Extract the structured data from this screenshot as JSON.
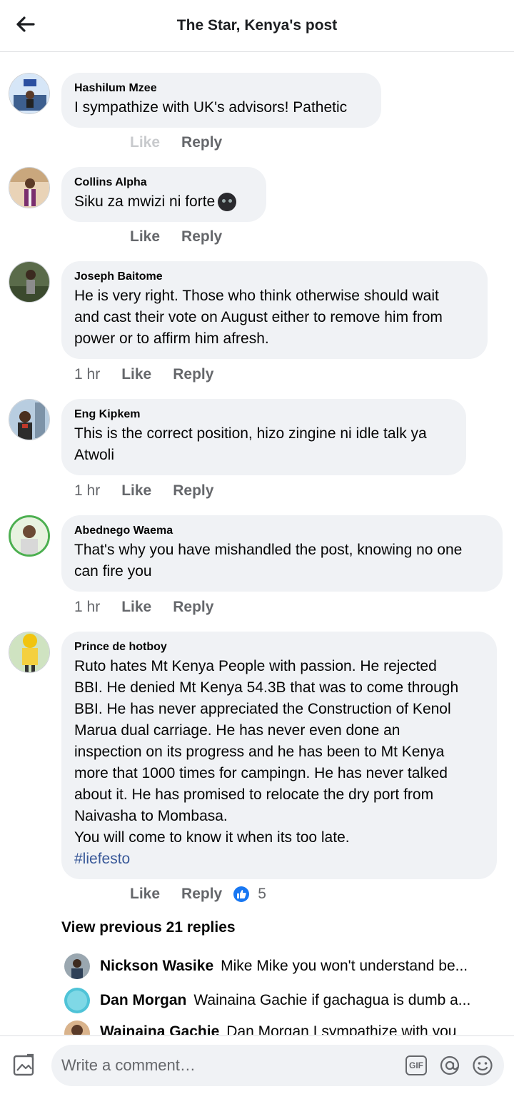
{
  "header": {
    "title": "The Star, Kenya's post"
  },
  "comments": [
    {
      "author": "Hashilum Mzee",
      "text": "I sympathize with UK's advisors! Pathetic",
      "time": "",
      "like": "Like",
      "reply": "Reply"
    },
    {
      "author": "Collins Alpha",
      "text": "Siku za mwizi ni forte",
      "time": "",
      "like": "Like",
      "reply": "Reply"
    },
    {
      "author": "Joseph Baitome",
      "text": "He is very right. Those who think otherwise should wait\nand cast their vote on August either to remove him from\npower or to affirm him afresh.",
      "time": "1 hr",
      "like": "Like",
      "reply": "Reply"
    },
    {
      "author": "Eng Kipkem",
      "text": "This is the correct position, hizo zingine ni idle talk ya\nAtwoli",
      "time": "1 hr",
      "like": "Like",
      "reply": "Reply"
    },
    {
      "author": "Abednego Waema",
      "text": "That's why you have mishandled the post, knowing no one\ncan fire you",
      "time": "1 hr",
      "like": "Like",
      "reply": "Reply"
    },
    {
      "author": "Prince de hotboy",
      "text": "Ruto hates Mt Kenya People with passion. He rejected\nBBI. He denied Mt Kenya 54.3B that was to come through\nBBI. He has never appreciated the Construction of Kenol\nMarua dual carriage. He has never even done an\ninspection on its progress and he has been to Mt Kenya\nmore that 1000 times for campingn. He has never talked\nabout it. He has promised to relocate the dry port from\nNaivasha to Mombasa.\nYou will come to know it when its too late.",
      "hashtag": "#liefesto",
      "time": "",
      "like": "Like",
      "reply": "Reply",
      "reaction_count": "5"
    }
  ],
  "view_previous": "View previous 21 replies",
  "replies": [
    {
      "author": "Nickson Wasike",
      "text": "Mike Mike  you won't understand be..."
    },
    {
      "author": "Dan Morgan",
      "text": "Wainaina Gachie if gachagua is dumb a..."
    },
    {
      "author": "Wainaina Gachie",
      "text": "Dan Morgan I sympathize with you"
    }
  ],
  "composer": {
    "placeholder": "Write a comment…",
    "gif_label": "GIF"
  },
  "icons": {
    "back": "arrow-left-icon",
    "photo": "photo-icon",
    "at": "at-icon",
    "emoji": "smiley-icon",
    "like_reaction": "thumbs-up-icon"
  },
  "colors": {
    "bubble": "#f0f2f5",
    "hashtag": "#385898",
    "meta": "#65676b",
    "accent": "#1877f2"
  }
}
